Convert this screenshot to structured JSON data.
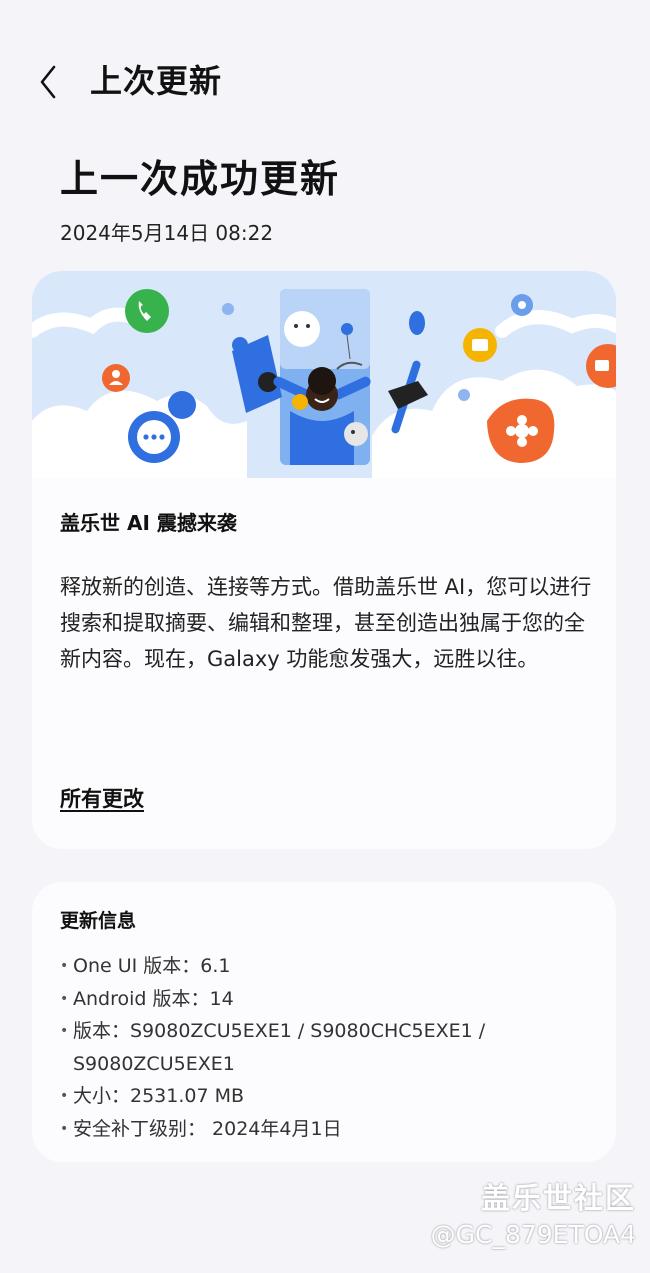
{
  "header": {
    "back_icon": "chevron-left-icon",
    "title": "上次更新"
  },
  "status": {
    "title": "上一次成功更新",
    "date": "2024年5月14日 08:22"
  },
  "feature": {
    "title": "盖乐世 AI 震撼来袭",
    "description": "释放新的创造、连接等方式。借助盖乐世 AI，您可以进行搜索和提取摘要、编辑和整理，甚至创造出独属于您的全新内容。现在，Galaxy 功能愈发强大，远胜以往。",
    "all_changes_link": "所有更改",
    "banner_icons": [
      "phone-icon",
      "person-icon",
      "chat-bubble-icon",
      "gear-icon",
      "folder-icon",
      "flower-icon",
      "camera-icon"
    ]
  },
  "update_info": {
    "title": "更新信息",
    "items": [
      "One UI 版本：6.1",
      "Android 版本：14",
      "版本：S9080ZCU5EXE1 / S9080CHC5EXE1 / S9080ZCU5EXE1",
      "大小：2531.07 MB",
      "安全补丁级别： 2024年4月1日"
    ]
  },
  "watermark": {
    "brand": "盖乐世社区",
    "user": "@GC_879ETOA4"
  },
  "colors": {
    "background": "#f4f4f9",
    "card": "#fcfcfe",
    "accent_blue": "#2f6fe0",
    "accent_green": "#37b24d",
    "accent_orange": "#f06830",
    "accent_yellow": "#f5b400"
  }
}
